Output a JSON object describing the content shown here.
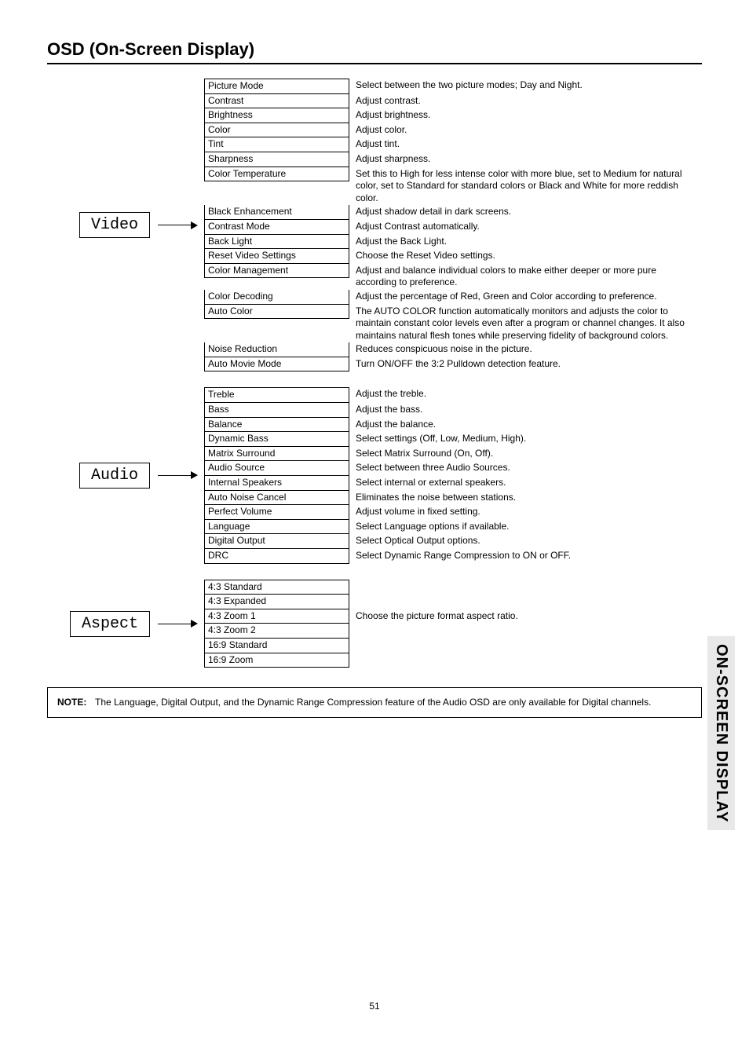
{
  "pageTitle": "OSD (On-Screen Display)",
  "sideTab": "ON-SCREEN DISPLAY",
  "pageNumber": "51",
  "note": {
    "label": "NOTE:",
    "text": "The Language, Digital Output, and the Dynamic Range Compression feature of the Audio OSD are only available for Digital channels."
  },
  "sections": [
    {
      "name": "Video",
      "items": [
        {
          "term": "Picture Mode",
          "desc": "Select between the two picture modes; Day and Night."
        },
        {
          "term": "Contrast",
          "desc": "Adjust contrast."
        },
        {
          "term": "Brightness",
          "desc": "Adjust brightness."
        },
        {
          "term": "Color",
          "desc": "Adjust color."
        },
        {
          "term": "Tint",
          "desc": "Adjust tint."
        },
        {
          "term": "Sharpness",
          "desc": "Adjust sharpness."
        },
        {
          "term": "Color Temperature",
          "desc": "Set this to High for less intense color with more blue, set to Medium for natural color, set to Standard for standard colors or Black and White for more reddish color."
        },
        {
          "term": "Black Enhancement",
          "desc": "Adjust shadow detail in dark screens."
        },
        {
          "term": "Contrast Mode",
          "desc": "Adjust Contrast automatically."
        },
        {
          "term": "Back Light",
          "desc": "Adjust the Back Light."
        },
        {
          "term": "Reset Video Settings",
          "desc": "Choose the Reset Video settings."
        },
        {
          "term": "Color Management",
          "desc": "Adjust and balance individual colors to make either deeper or more pure according to preference."
        },
        {
          "term": "Color Decoding",
          "desc": "Adjust the percentage of Red, Green and Color according to preference."
        },
        {
          "term": "Auto Color",
          "desc": "The AUTO COLOR function automatically monitors and adjusts the color to maintain constant color levels even after a program or channel changes. It also maintains natural flesh tones while preserving fidelity of background colors."
        },
        {
          "term": "Noise Reduction",
          "desc": "Reduces conspicuous noise in the picture."
        },
        {
          "term": "Auto Movie Mode",
          "desc": "Turn ON/OFF the 3:2 Pulldown detection feature."
        }
      ]
    },
    {
      "name": "Audio",
      "items": [
        {
          "term": "Treble",
          "desc": "Adjust the treble."
        },
        {
          "term": "Bass",
          "desc": "Adjust the bass."
        },
        {
          "term": "Balance",
          "desc": "Adjust the balance."
        },
        {
          "term": "Dynamic Bass",
          "desc": "Select settings (Off, Low, Medium, High)."
        },
        {
          "term": "Matrix Surround",
          "desc": "Select Matrix Surround (On, Off)."
        },
        {
          "term": "Audio Source",
          "desc": "Select between three Audio Sources."
        },
        {
          "term": "Internal Speakers",
          "desc": "Select internal or external speakers."
        },
        {
          "term": "Auto Noise Cancel",
          "desc": "Eliminates the noise between stations."
        },
        {
          "term": "Perfect Volume",
          "desc": "Adjust volume in fixed setting."
        },
        {
          "term": "Language",
          "desc": "Select Language options if available."
        },
        {
          "term": "Digital Output",
          "desc": "Select Optical Output options."
        },
        {
          "term": "DRC",
          "desc": "Select Dynamic Range Compression to ON or OFF."
        }
      ]
    },
    {
      "name": "Aspect",
      "desc": "Choose the picture format aspect ratio.",
      "items": [
        {
          "term": "4:3 Standard"
        },
        {
          "term": "4:3 Expanded"
        },
        {
          "term": "4:3 Zoom 1"
        },
        {
          "term": "4:3 Zoom 2"
        },
        {
          "term": "16:9 Standard"
        },
        {
          "term": "16:9 Zoom"
        }
      ]
    }
  ]
}
